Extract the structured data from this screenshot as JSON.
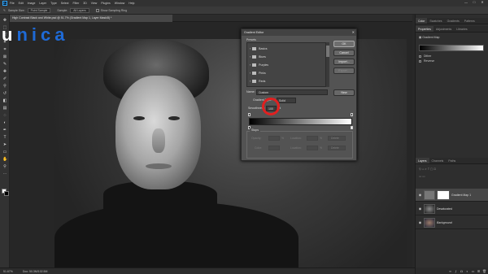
{
  "menubar": {
    "app_badge": "Ps",
    "items": [
      "File",
      "Edit",
      "Image",
      "Layer",
      "Type",
      "Select",
      "Filter",
      "3D",
      "View",
      "Plugins",
      "Window",
      "Help"
    ],
    "window_controls": [
      "—",
      "□",
      "✕"
    ]
  },
  "optionsbar": {
    "sample_size_label": "Sample Size:",
    "sample_size_value": "Point Sample",
    "sample_label": "Sample:",
    "sample_value": "All Layers",
    "show_ring_label": "Show Sampling Ring"
  },
  "document": {
    "tab_title": "High Contrast Black and White.psd @ 51.7% (Gradient Map 1, Layer Mask/8) *"
  },
  "logo": {
    "first": "u",
    "rest": "nica"
  },
  "statusbar": {
    "zoom": "51.67%",
    "doc_info": "Doc: 50.3M/102.5M"
  },
  "right_panel": {
    "top_tabs": [
      "Color",
      "Swatches",
      "Gradients",
      "Patterns"
    ],
    "prop_tabs": [
      "Properties",
      "Adjustments",
      "Libraries"
    ],
    "prop_title": "Gradient Map",
    "dither_label": "Dither",
    "reverse_label": "Reverse",
    "layer_tabs": [
      "Layers",
      "Channels",
      "Paths"
    ],
    "layers": [
      {
        "name": "Gradient Map 1",
        "selected": true
      },
      {
        "name": "Desaturated",
        "selected": false
      },
      {
        "name": "Background",
        "selected": false
      }
    ]
  },
  "gradient_editor": {
    "title": "Gradient Editor",
    "close": "✕",
    "presets_label": "Presets",
    "presets": [
      "Basics",
      "Blues",
      "Purples",
      "Pinks",
      "Reds"
    ],
    "buttons": {
      "ok": "OK",
      "cancel": "Cancel",
      "import": "Import...",
      "export": "Export...",
      "new": "New"
    },
    "name_label": "Name:",
    "name_value": "Custom",
    "gradient_type_label": "Gradient Type:",
    "gradient_type_value": "Solid",
    "smoothness_label": "Smoothness:",
    "smoothness_value": "100",
    "smoothness_unit": "%",
    "stops_label": "Stops",
    "opacity_label": "Opacity:",
    "location_label": "Location:",
    "delete_label": "Delete",
    "color_label": "Color:",
    "stops_pct": "%"
  },
  "colors": {
    "highlight": "#e02020",
    "logo_blue": "#1e6ad6"
  }
}
